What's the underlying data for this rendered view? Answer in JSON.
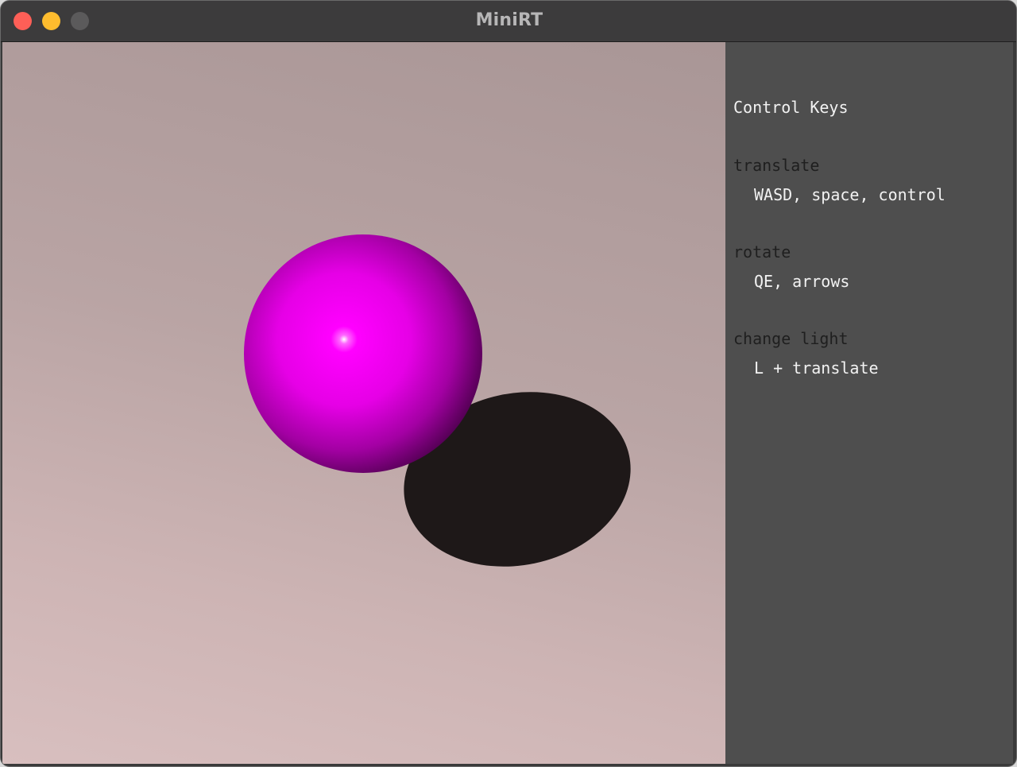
{
  "window": {
    "title": "MiniRT",
    "colors": {
      "close": "#fe5f57",
      "minimize": "#febc2e",
      "zoom": "#5b5a5b"
    }
  },
  "scene": {
    "sphere_color": "#ff00ff",
    "shadow_color": "#1e1818",
    "background_color": "#c2adad"
  },
  "panel": {
    "heading": "Control Keys",
    "sections": [
      {
        "name": "translate",
        "keys": "WASD, space, control"
      },
      {
        "name": "rotate",
        "keys": "QE, arrows"
      },
      {
        "name": "change light",
        "keys": "L + translate"
      }
    ]
  }
}
